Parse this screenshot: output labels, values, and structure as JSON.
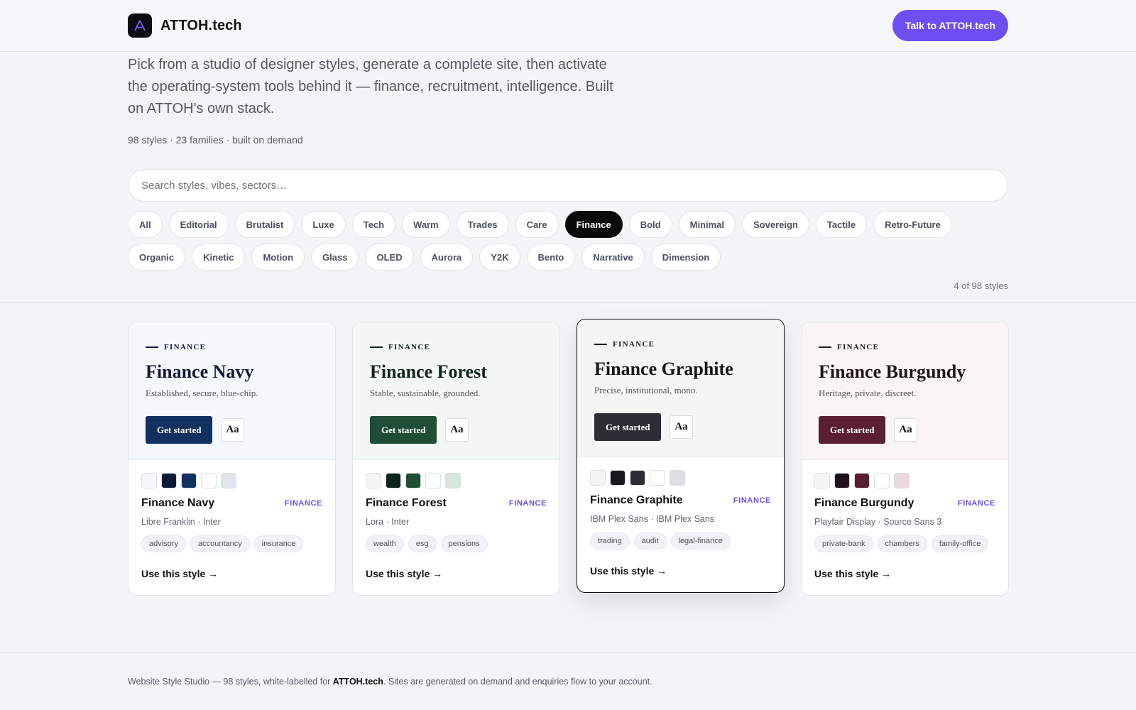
{
  "header": {
    "brand": "ATTOH.tech",
    "cta_label": "Talk to ATTOH.tech",
    "accent_color": "#6d4ef0"
  },
  "hero": {
    "description": "Pick from a studio of designer styles, generate a complete site, then activate the operating-system tools behind it — finance, recruitment, intelligence. Built on ATTOH's own stack.",
    "meta": "98 styles · 23 families · built on demand"
  },
  "search": {
    "placeholder": "Search styles, vibes, sectors…",
    "value": ""
  },
  "filters": {
    "active": "Finance",
    "items": [
      "All",
      "Editorial",
      "Brutalist",
      "Luxe",
      "Tech",
      "Warm",
      "Trades",
      "Care",
      "Finance",
      "Bold",
      "Minimal",
      "Sovereign",
      "Tactile",
      "Retro-Future",
      "Organic",
      "Kinetic",
      "Motion",
      "Glass",
      "OLED",
      "Aurora",
      "Y2K",
      "Bento",
      "Narrative",
      "Dimension"
    ]
  },
  "result_count": "4 of 98 styles",
  "cards": [
    {
      "eyebrow": "FINANCE",
      "preview_title": "Finance Navy",
      "tagline": "Established, secure, blue-chip.",
      "button_label": "Get started",
      "aa_label": "Aa",
      "name": "Finance Navy",
      "family": "FINANCE",
      "fonts": "Libre Franklin · Inter",
      "tags": [
        "advisory",
        "accountancy",
        "insurance"
      ],
      "link_label": "Use this style →",
      "preview_bg": "#f5f8fa",
      "ink": "#0d1b3a",
      "primary": "#13315f",
      "swatches": [
        "#f5f8fa",
        "#0c1a38",
        "#13315f",
        "#ffffff",
        "#dfe5ee"
      ]
    },
    {
      "eyebrow": "FINANCE",
      "preview_title": "Finance Forest",
      "tagline": "Stable, sustainable, grounded.",
      "button_label": "Get started",
      "aa_label": "Aa",
      "name": "Finance Forest",
      "family": "FINANCE",
      "fonts": "Lora · Inter",
      "tags": [
        "wealth",
        "esg",
        "pensions"
      ],
      "link_label": "Use this style →",
      "preview_bg": "#f3f7f3",
      "ink": "#0f2617",
      "primary": "#1f4d35",
      "swatches": [
        "#f3f7f3",
        "#10251a",
        "#1f4d35",
        "#ffffff",
        "#d6e6d9"
      ]
    },
    {
      "eyebrow": "FINANCE",
      "preview_title": "Finance Graphite",
      "tagline": "Precise, institutional, mono.",
      "button_label": "Get started",
      "aa_label": "Aa",
      "name": "Finance Graphite",
      "family": "FINANCE",
      "fonts": "IBM Plex Sans · IBM Plex Sans",
      "tags": [
        "trading",
        "audit",
        "legal-finance"
      ],
      "link_label": "Use this style →",
      "preview_bg": "#f4f5f5",
      "ink": "#151719",
      "primary": "#2b2f35",
      "swatches": [
        "#f4f5f5",
        "#17191c",
        "#2b2f35",
        "#ffffff",
        "#dcdee1"
      ]
    },
    {
      "eyebrow": "FINANCE",
      "preview_title": "Finance Burgundy",
      "tagline": "Heritage, private, discreet.",
      "button_label": "Get started",
      "aa_label": "Aa",
      "name": "Finance Burgundy",
      "family": "FINANCE",
      "fonts": "Playfair Display · Source Sans 3",
      "tags": [
        "private-bank",
        "chambers",
        "family-office"
      ],
      "link_label": "Use this style →",
      "preview_bg": "#f8f5f4",
      "ink": "#22141a",
      "primary": "#5a1f30",
      "swatches": [
        "#f7f4f4",
        "#1f141a",
        "#5a1f30",
        "#ffffff",
        "#ead9dc"
      ]
    }
  ],
  "footer": {
    "prefix": "Website Style Studio — 98 styles, white-labelled for ",
    "brand": "ATTOH.tech",
    "suffix": ". Sites are generated on demand and enquiries flow to your account."
  }
}
